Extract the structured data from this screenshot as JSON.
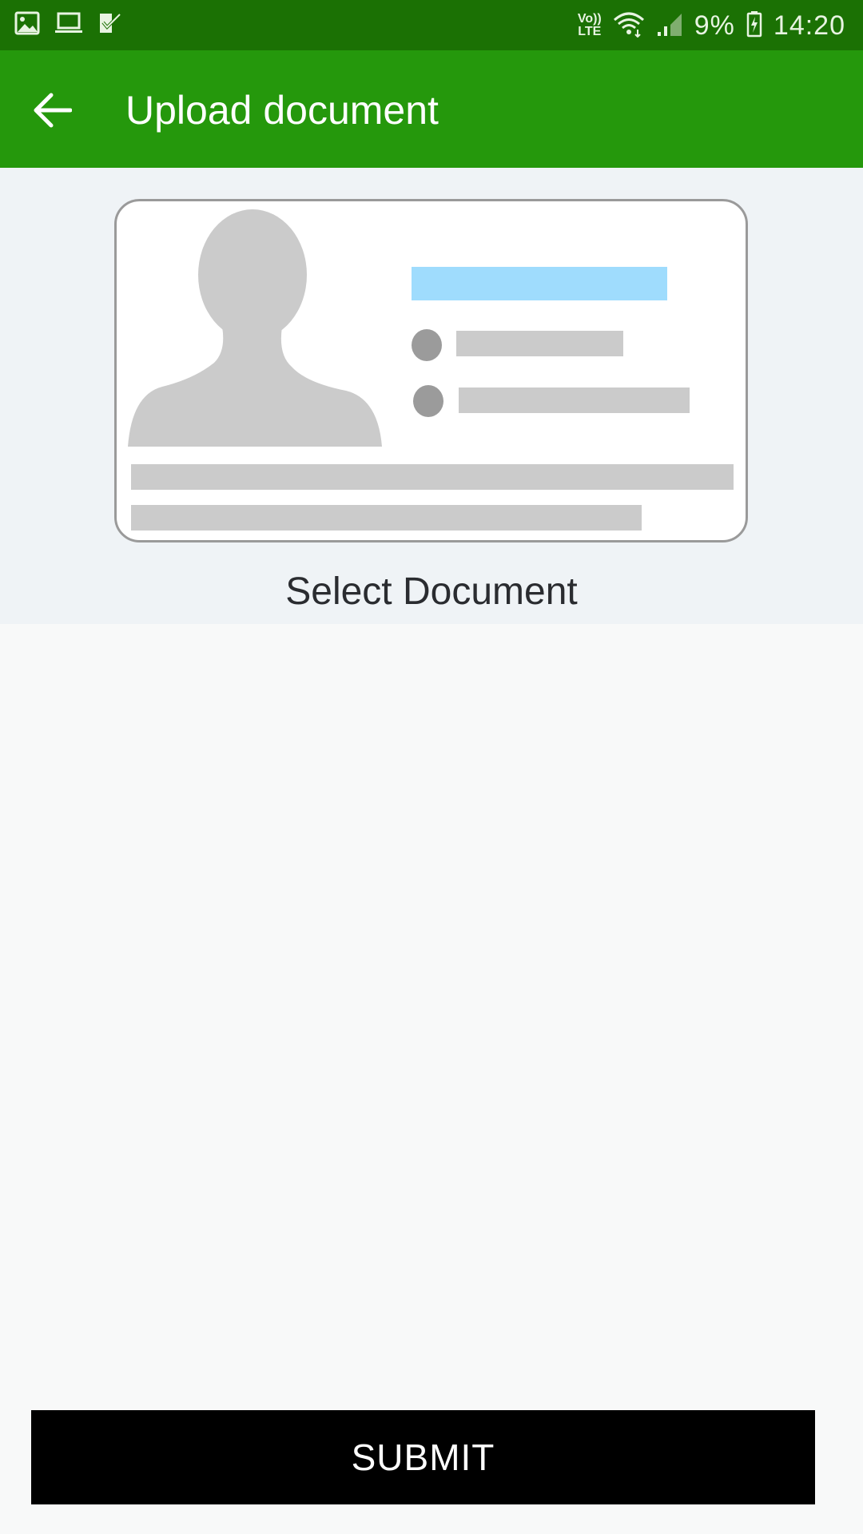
{
  "status_bar": {
    "left_icons": [
      "gallery-icon",
      "laptop-icon",
      "task-check-icon"
    ],
    "volte_top": "Vo))",
    "volte_bottom": "LTE",
    "battery_percent": "9%",
    "time": "14:20"
  },
  "app_bar": {
    "back_icon": "arrow-back-icon",
    "title": "Upload document",
    "background": "#25980c"
  },
  "document": {
    "select_label": "Select Document",
    "placeholder_icon": "id-card-placeholder-icon"
  },
  "submit": {
    "label": "SUBMIT"
  },
  "colors": {
    "status_bar": "#1b7104",
    "app_bar": "#25980c",
    "doc_area": "#eff3f6",
    "page": "#f8f9f9",
    "card_accent": "#9fdcfd",
    "submit": "#000000"
  }
}
